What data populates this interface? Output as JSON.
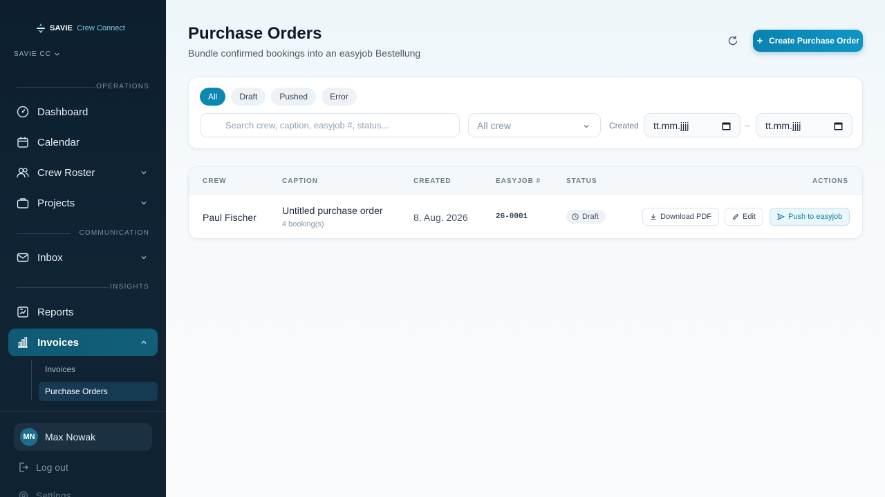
{
  "brand": {
    "name": "SAVIE",
    "sub": "Crew Connect"
  },
  "workspace": "SAVIE CC",
  "sections": {
    "operations": "OPERATIONS",
    "communication": "COMMUNICATION",
    "insights": "INSIGHTS"
  },
  "nav": {
    "dashboard": "Dashboard",
    "calendar": "Calendar",
    "crew_roster": "Crew Roster",
    "projects": "Projects",
    "inbox": "Inbox",
    "reports": "Reports",
    "invoices": "Invoices"
  },
  "subnav": {
    "invoices": "Invoices",
    "purchase_orders": "Purchase Orders"
  },
  "user": {
    "initials": "MN",
    "name": "Max Nowak"
  },
  "logout": "Log out",
  "settings": "Settings",
  "page": {
    "title": "Purchase Orders",
    "subtitle": "Bundle confirmed bookings into an easyjob Bestellung"
  },
  "create_button": "Create Purchase Order",
  "filters": {
    "chips": [
      "All",
      "Draft",
      "Pushed",
      "Error"
    ],
    "search_placeholder": "Search crew, caption, easyjob #, status...",
    "crew_select": "All crew",
    "created_label": "Created",
    "date_from": "tt.mm.jjjj",
    "date_to": "tt.mm.jjjj",
    "date_separator": "–"
  },
  "table": {
    "headers": {
      "crew": "CREW",
      "caption": "CAPTION",
      "created": "CREATED",
      "easyjob": "EASYJOB #",
      "status": "STATUS",
      "actions": "ACTIONS"
    },
    "rows": [
      {
        "crew": "Paul Fischer",
        "caption": "Untitled purchase order",
        "caption_sub": "4 booking(s)",
        "created": "8. Aug. 2026",
        "easyjob": "26-0001",
        "status": "Draft"
      }
    ],
    "actions": {
      "download": "Download PDF",
      "edit": "Edit",
      "push": "Push to easyjob"
    }
  },
  "colors": {
    "accent": "#0c86b3",
    "sidebar": "#0d1f2e",
    "active_nav": "#0f5a74"
  }
}
